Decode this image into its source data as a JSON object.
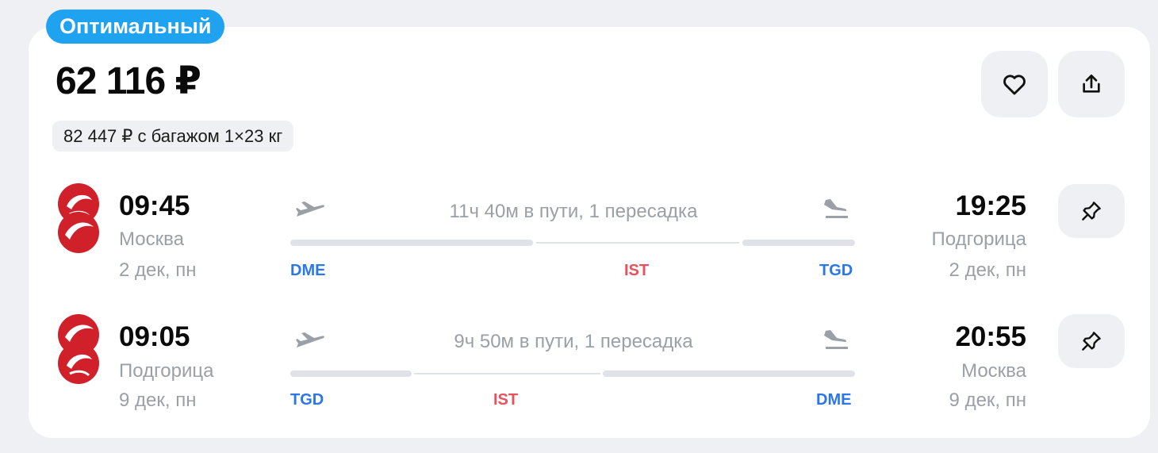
{
  "offer": {
    "badge": "Оптимальный",
    "price": "62 116 ₽",
    "baggage_price": "82 447 ₽ с багажом 1×23 кг"
  },
  "colors": {
    "badge": "#1fa2f0",
    "airport_code": "#2b77e6",
    "transfer_code": "#e8505b",
    "airline_logo": "#d0202a"
  },
  "icons": {
    "favorite": "heart-icon",
    "share": "share-icon",
    "pin": "pin-icon",
    "departure": "takeoff-icon",
    "arrival": "landing-icon",
    "airline": "airline-logo"
  },
  "flights": [
    {
      "departure_time": "09:45",
      "departure_city": "Москва",
      "departure_date": "2 дек, пн",
      "duration": "11ч 40м в пути, 1 пересадка",
      "arrival_time": "19:25",
      "arrival_city": "Подгорица",
      "arrival_date": "2 дек, пн",
      "from_code": "DME",
      "transfer_code": "IST",
      "to_code": "TGD"
    },
    {
      "departure_time": "09:05",
      "departure_city": "Подгорица",
      "departure_date": "9 дек, пн",
      "duration": "9ч 50м в пути, 1 пересадка",
      "arrival_time": "20:55",
      "arrival_city": "Москва",
      "arrival_date": "9 дек, пн",
      "from_code": "TGD",
      "transfer_code": "IST",
      "to_code": "DME"
    }
  ]
}
